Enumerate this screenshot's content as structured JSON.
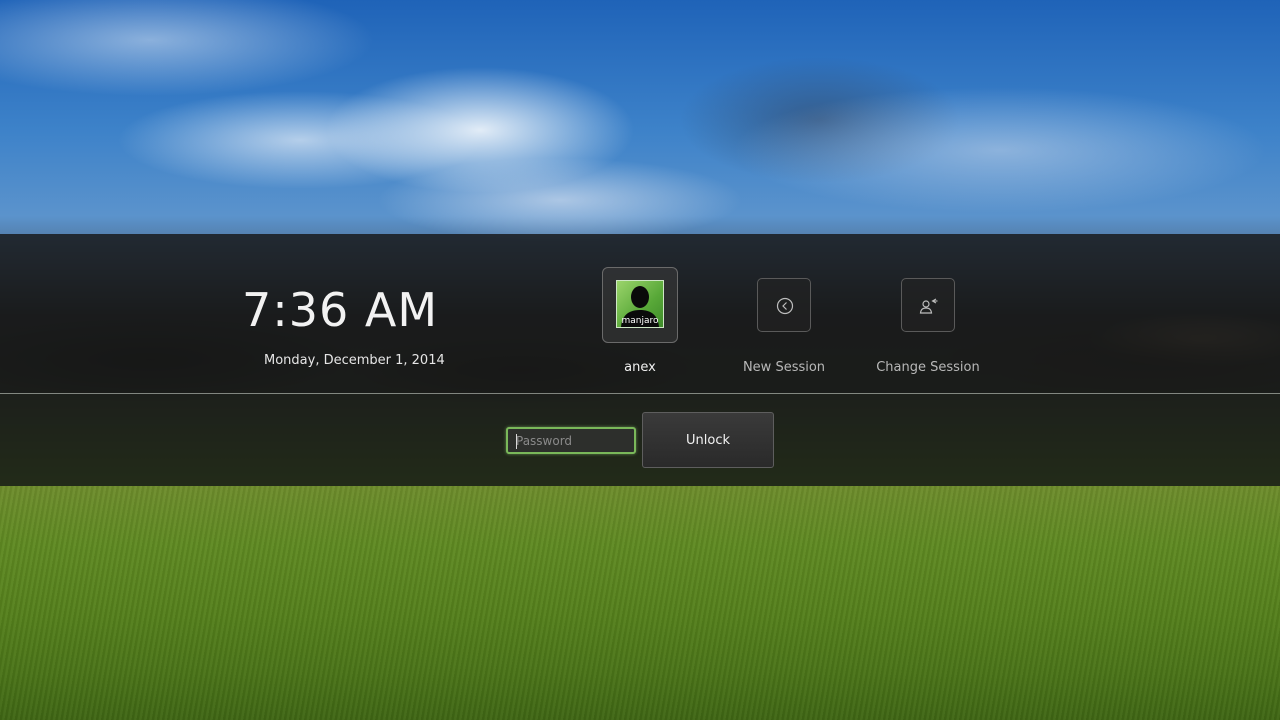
{
  "clock": {
    "time": "7:36 AM",
    "date": "Monday, December 1, 2014"
  },
  "user": {
    "name": "anex",
    "avatar_text": "manjaro",
    "avatar_icon": "user-silhouette-icon"
  },
  "actions": [
    {
      "label": "New Session",
      "icon": "arrow-left-circle-icon"
    },
    {
      "label": "Change Session",
      "icon": "switch-user-icon"
    }
  ],
  "login": {
    "password_placeholder": "Password",
    "password_value": "",
    "unlock_label": "Unlock"
  },
  "colors": {
    "accent_focus": "#7ab85a",
    "panel": "#161616"
  }
}
